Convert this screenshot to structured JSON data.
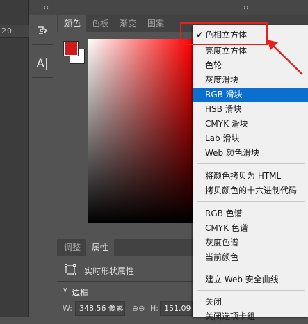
{
  "top_bar": {
    "collapse_left": "‹‹",
    "collapse_right": "››",
    "ruler_text": "20"
  },
  "color_panel": {
    "tabs": [
      "颜色",
      "色板",
      "渐变",
      "图案"
    ],
    "foreground_color": "#d11a1a",
    "background_color": "#ffffff",
    "hue": "red"
  },
  "tools": {
    "text_tool_label": "A|"
  },
  "properties_panel": {
    "tabs": [
      "调整",
      "属性"
    ],
    "shape_label": "实时形状属性",
    "section_title": "边框",
    "w_label": "W:",
    "w_value": "348.56 像素",
    "h_label": "H:",
    "h_value": "151.09"
  },
  "menu": {
    "checked_mark": "✔",
    "groups": [
      [
        "色相立方体",
        "亮度立方体",
        "色轮",
        "灰度滑块",
        "RGB 滑块",
        "HSB 滑块",
        "CMYK 滑块",
        "Lab 滑块",
        "Web 颜色滑块"
      ],
      [
        "将颜色拷贝为 HTML",
        "拷贝颜色的十六进制代码"
      ],
      [
        "RGB 色谱",
        "CMYK 色谱",
        "灰度色谱",
        "当前颜色"
      ],
      [
        "建立 Web 安全曲线"
      ],
      [
        "关闭",
        "关闭选项卡组"
      ]
    ],
    "selected_item": "RGB 滑块",
    "checked_item": "色相立方体"
  },
  "annotation": {
    "color": "#e8201c"
  }
}
